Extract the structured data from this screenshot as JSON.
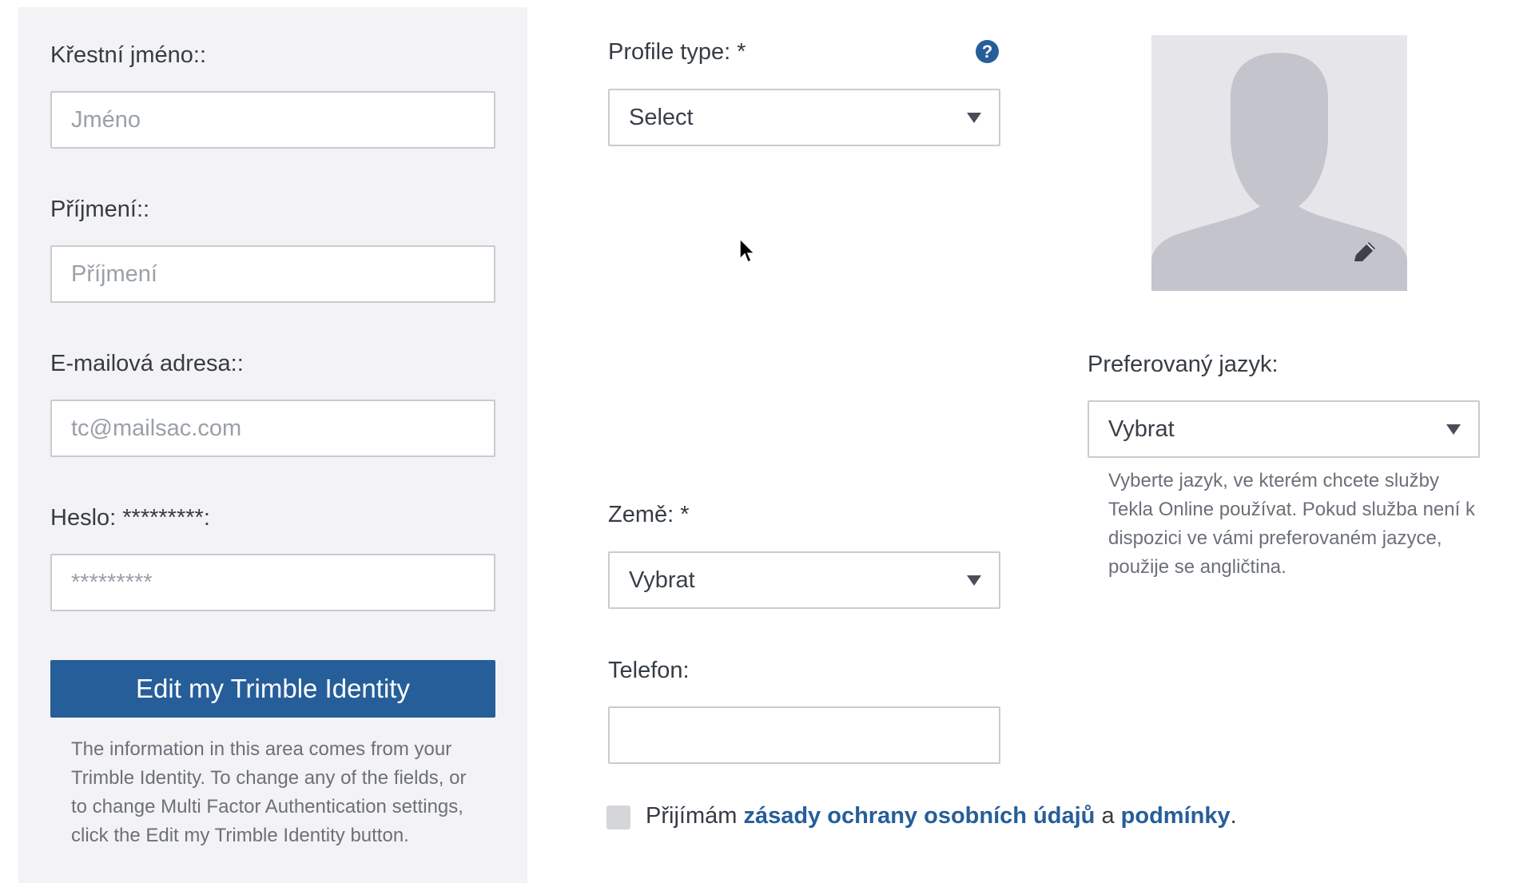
{
  "left": {
    "first_name": {
      "label": "Křestní jméno::",
      "placeholder": "Jméno"
    },
    "last_name": {
      "label": "Příjmení::",
      "placeholder": "Příjmení"
    },
    "email": {
      "label": "E-mailová adresa::",
      "placeholder": "tc@mailsac.com"
    },
    "password": {
      "label": "Heslo: *********:",
      "placeholder": "*********"
    },
    "edit_button": "Edit my Trimble Identity",
    "info_text": "The information in this area comes from your Trimble Identity. To change any of the fields, or to change Multi Factor Authentication settings, click the Edit my Trimble Identity button."
  },
  "middle": {
    "profile_type": {
      "label": "Profile type: *",
      "value": "Select",
      "help_icon": "?"
    },
    "country": {
      "label": "Země: *",
      "value": "Vybrat"
    },
    "phone": {
      "label": "Telefon:",
      "value": ""
    },
    "consent": {
      "prefix": "Přijímám",
      "privacy_link": "zásady ochrany osobních údajů",
      "conjunction": "a",
      "terms_link": "podmínky",
      "suffix": "."
    }
  },
  "right": {
    "avatar_icon": "user-silhouette-icon",
    "edit_icon": "pencil-icon",
    "language": {
      "label": "Preferovaný jazyk:",
      "value": "Vybrat",
      "help": "Vyberte jazyk, ve kterém chcete služby Tekla Online používat. Pokud služba není k dispozici ve vámi preferovaném jazyce, použije se angličtina."
    }
  },
  "colors": {
    "accent": "#265e99",
    "panel_bg": "#f3f3f5",
    "border": "#c9cbd0",
    "avatar_bg": "#e6e6ea",
    "avatar_silhouette": "#c4c4cc"
  }
}
